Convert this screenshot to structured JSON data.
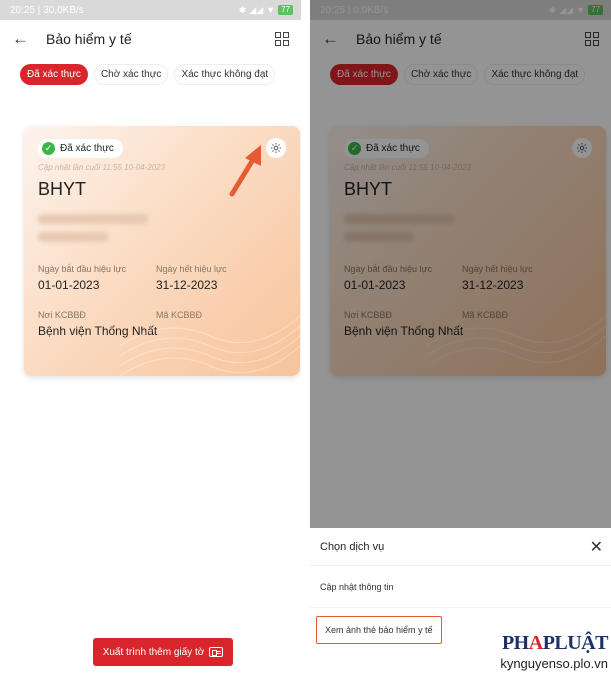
{
  "screens": {
    "left": {
      "status": {
        "time": "20:25",
        "speed": "30,0KB/s",
        "battery": "77"
      },
      "title": "Bảo hiểm y tế",
      "tabs": [
        "Đã xác thực",
        "Chờ xác thực",
        "Xác thực không đạt"
      ],
      "card": {
        "badge": "Đã xác thực",
        "updated": "Cập nhật lần cuối 11:55 10-04-2023",
        "title": "BHYT",
        "start_label": "Ngày bắt đầu hiệu lực",
        "start_value": "01-01-2023",
        "end_label": "Ngày hết hiệu lực",
        "end_value": "31-12-2023",
        "place_label": "Nơi KCBBĐ",
        "place_value": "Bệnh viện Thống Nhất",
        "code_label": "Mã KCBBĐ"
      },
      "export_button": "Xuất trình thêm giấy tờ"
    },
    "right": {
      "status": {
        "time": "20:25",
        "speed": "0,0KB/s",
        "battery": "77"
      },
      "title": "Bảo hiểm y tế",
      "tabs": [
        "Đã xác thực",
        "Chờ xác thực",
        "Xác thực không đạt"
      ],
      "card": {
        "badge": "Đã xác thực",
        "updated": "Cập nhật lần cuối 11:55 10-04-2023",
        "title": "BHYT",
        "start_label": "Ngày bắt đầu hiệu lực",
        "start_value": "01-01-2023",
        "end_label": "Ngày hết hiệu lực",
        "end_value": "31-12-2023",
        "place_label": "Nơi KCBBĐ",
        "place_value": "Bệnh viện Thống Nhất",
        "code_label": "Mã KCBBĐ"
      },
      "sheet": {
        "title": "Chọn dịch vụ",
        "options": [
          "Cập nhật thông tin",
          "Xem ảnh thẻ bảo hiểm y tế"
        ]
      }
    }
  },
  "watermark": {
    "logo_a": "PH",
    "logo_red": "A",
    "logo_b": "PLUẬT",
    "url": "kynguyenso.plo.vn"
  },
  "icons": {
    "back": "arrow-left-icon",
    "qr": "qr-code-icon",
    "check": "check-circle-icon",
    "gear": "gear-icon",
    "close": "close-icon",
    "idcard": "id-card-icon",
    "annotation": "red-arrow-icon"
  },
  "colors": {
    "accent_red": "#d9262c",
    "check_green": "#3cb64a",
    "highlight_orange": "#e55b35",
    "logo_navy": "#1f3166"
  }
}
